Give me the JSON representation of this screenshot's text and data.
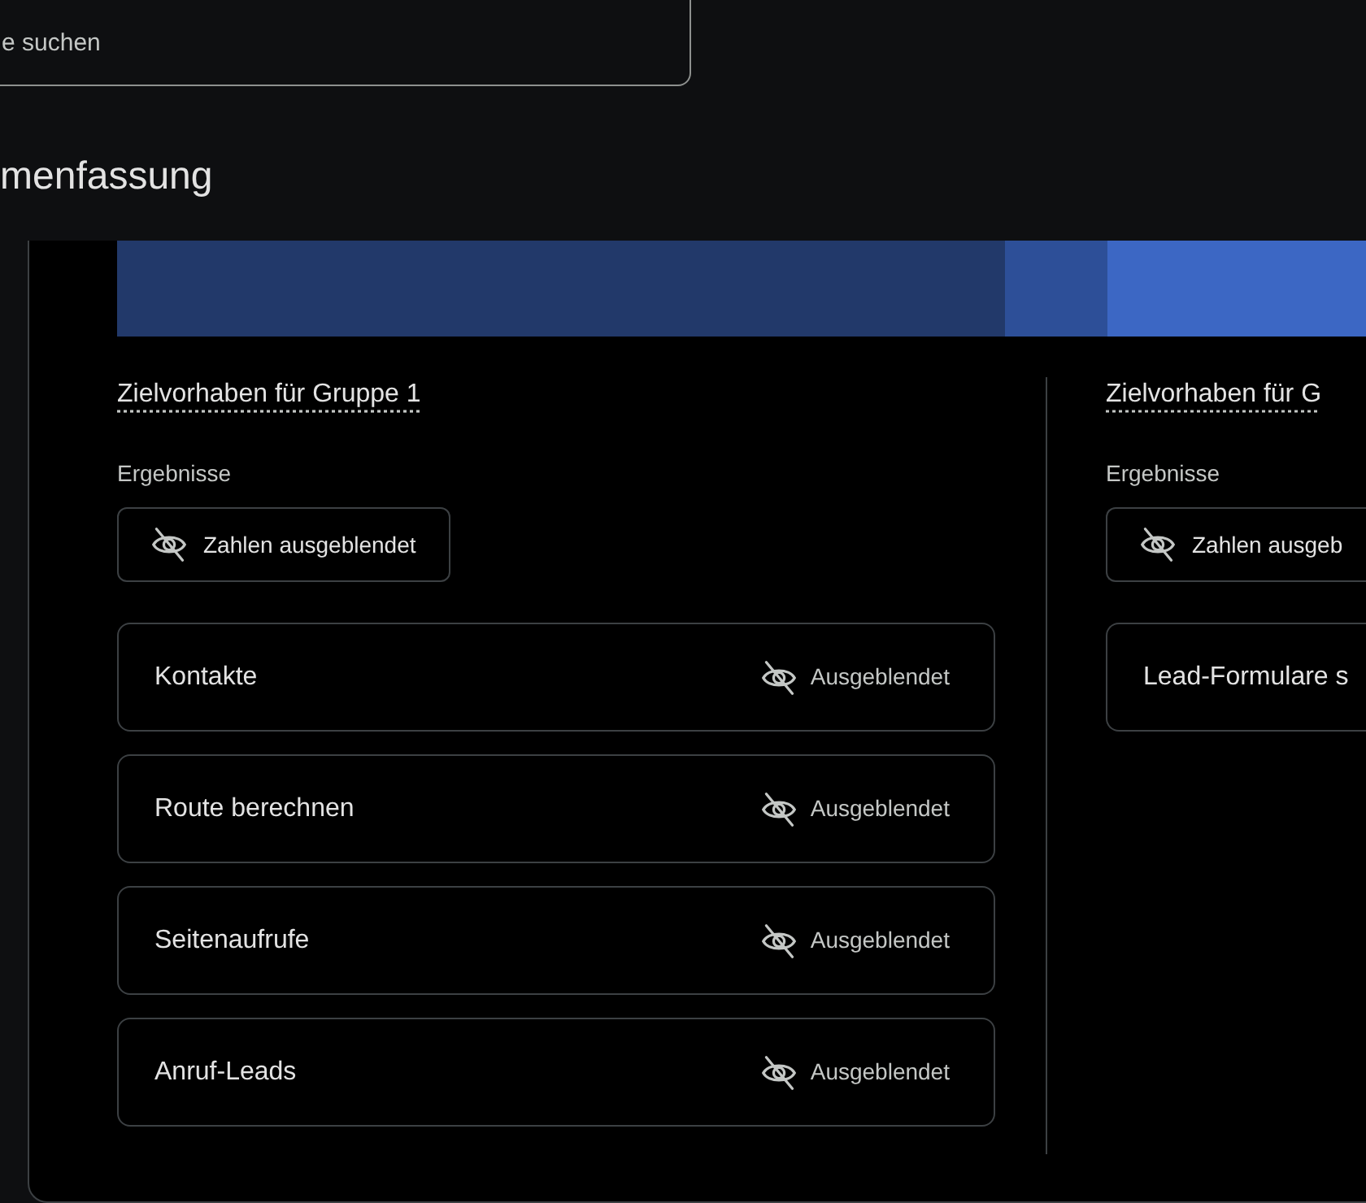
{
  "search": {
    "placeholder": "e suchen"
  },
  "heading": "menfassung",
  "groups": [
    {
      "title": "Zielvorhaben für Gruppe 1",
      "results_label": "Ergebnisse",
      "toggle": {
        "label": "Zahlen ausgeblendet"
      },
      "conversions": [
        {
          "name": "Kontakte",
          "status": "Ausgeblendet"
        },
        {
          "name": "Route berechnen",
          "status": "Ausgeblendet"
        },
        {
          "name": "Seitenaufrufe",
          "status": "Ausgeblendet"
        },
        {
          "name": "Anruf-Leads",
          "status": "Ausgeblendet"
        }
      ]
    },
    {
      "title": "Zielvorhaben für G",
      "results_label": "Ergebnisse",
      "toggle": {
        "label": "Zahlen ausgeb"
      },
      "conversions": [
        {
          "name": "Lead-Formulare s"
        }
      ]
    }
  ]
}
